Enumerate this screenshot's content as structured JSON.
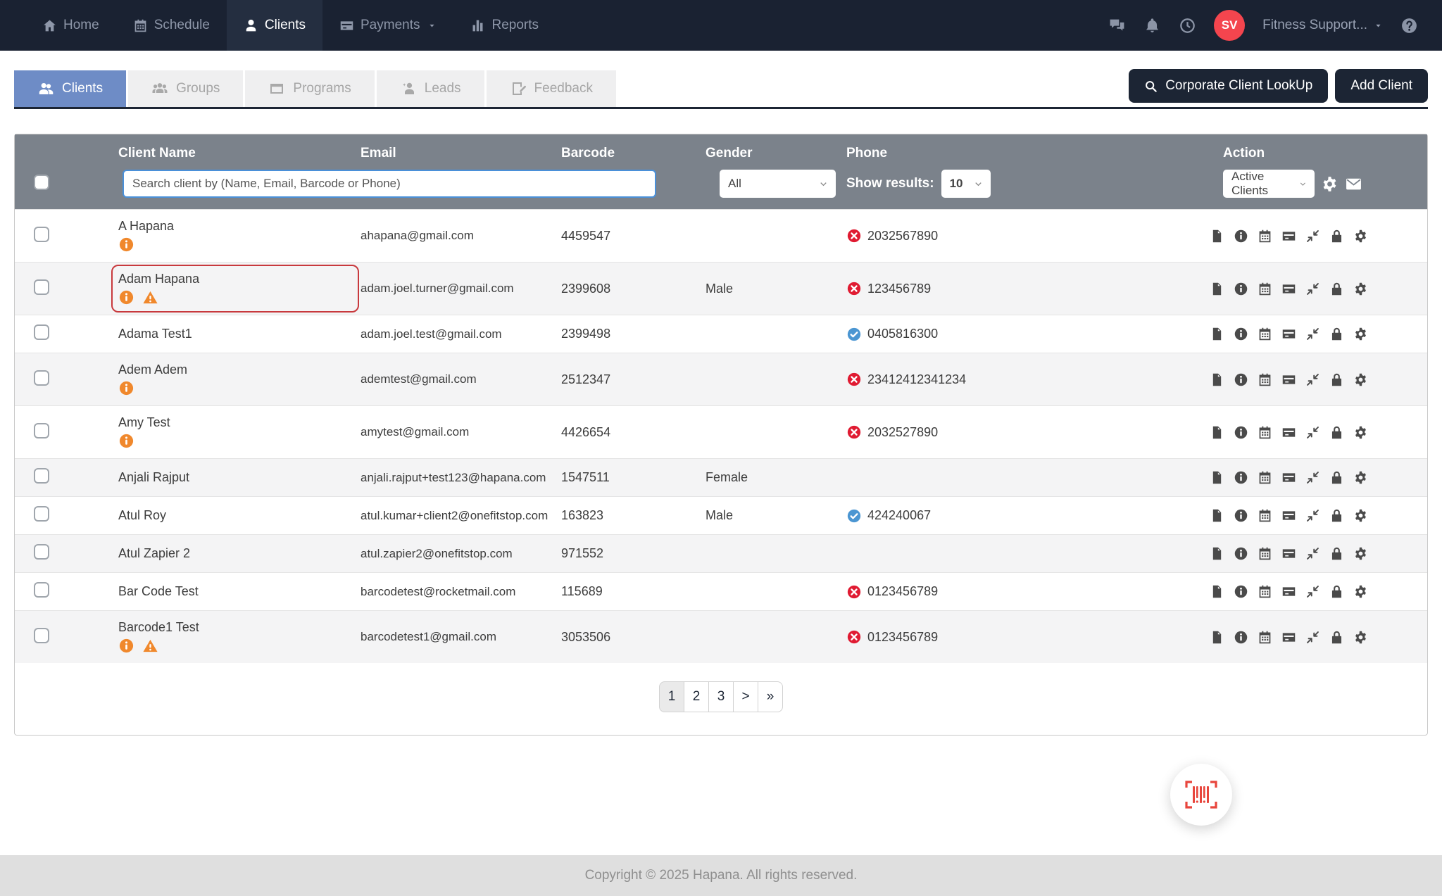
{
  "navbar": {
    "items": [
      {
        "label": "Home"
      },
      {
        "label": "Schedule"
      },
      {
        "label": "Clients"
      },
      {
        "label": "Payments"
      },
      {
        "label": "Reports"
      }
    ],
    "account": {
      "initials": "SV",
      "name": "Fitness Support..."
    }
  },
  "tabs": {
    "items": [
      {
        "label": "Clients"
      },
      {
        "label": "Groups"
      },
      {
        "label": "Programs"
      },
      {
        "label": "Leads"
      },
      {
        "label": "Feedback"
      }
    ]
  },
  "toolbar": {
    "corporate_lookup": "Corporate Client LookUp",
    "add_client": "Add Client"
  },
  "table": {
    "columns": {
      "name": "Client Name",
      "email": "Email",
      "barcode": "Barcode",
      "gender": "Gender",
      "phone": "Phone",
      "action": "Action"
    },
    "filters": {
      "search_placeholder": "Search client by (Name, Email, Barcode or Phone)",
      "gender": "All",
      "show_results_label": "Show results:",
      "show_results": "10",
      "list": "Active Clients"
    },
    "action_icons": [
      "notes-icon",
      "info-icon",
      "calendar-icon",
      "payment-card-icon",
      "merge-icon",
      "lock-icon",
      "settings-icon"
    ],
    "rows": [
      {
        "name": "A Hapana",
        "info": true,
        "warning": false,
        "email": "ahapana@gmail.com",
        "barcode": "4459547",
        "gender": "",
        "phone": "2032567890",
        "phone_status": "invalid",
        "highlighted": false
      },
      {
        "name": "Adam Hapana",
        "info": true,
        "warning": true,
        "email": "adam.joel.turner@gmail.com",
        "barcode": "2399608",
        "gender": "Male",
        "phone": "123456789",
        "phone_status": "invalid",
        "highlighted": true
      },
      {
        "name": "Adama Test1",
        "info": false,
        "warning": false,
        "email": "adam.joel.test@gmail.com",
        "barcode": "2399498",
        "gender": "",
        "phone": "0405816300",
        "phone_status": "verified",
        "highlighted": false
      },
      {
        "name": "Adem Adem",
        "info": true,
        "warning": false,
        "email": "ademtest@gmail.com",
        "barcode": "2512347",
        "gender": "",
        "phone": "23412412341234",
        "phone_status": "invalid",
        "highlighted": false
      },
      {
        "name": "Amy Test",
        "info": true,
        "warning": false,
        "email": "amytest@gmail.com",
        "barcode": "4426654",
        "gender": "",
        "phone": "2032527890",
        "phone_status": "invalid",
        "highlighted": false
      },
      {
        "name": "Anjali Rajput",
        "info": false,
        "warning": false,
        "email": "anjali.rajput+test123@hapana.com",
        "barcode": "1547511",
        "gender": "Female",
        "phone": "",
        "phone_status": null,
        "highlighted": false
      },
      {
        "name": "Atul Roy",
        "info": false,
        "warning": false,
        "email": "atul.kumar+client2@onefitstop.com",
        "barcode": "163823",
        "gender": "Male",
        "phone": "424240067",
        "phone_status": "verified",
        "highlighted": false
      },
      {
        "name": "Atul Zapier 2",
        "info": false,
        "warning": false,
        "email": "atul.zapier2@onefitstop.com",
        "barcode": "971552",
        "gender": "",
        "phone": "",
        "phone_status": null,
        "highlighted": false
      },
      {
        "name": "Bar Code Test",
        "info": false,
        "warning": false,
        "email": "barcodetest@rocketmail.com",
        "barcode": "115689",
        "gender": "",
        "phone": "0123456789",
        "phone_status": "invalid",
        "highlighted": false
      },
      {
        "name": "Barcode1 Test",
        "info": true,
        "warning": true,
        "email": "barcodetest1@gmail.com",
        "barcode": "3053506",
        "gender": "",
        "phone": "0123456789",
        "phone_status": "invalid",
        "highlighted": false
      }
    ]
  },
  "pagination": {
    "items": [
      "1",
      "2",
      "3",
      ">",
      "»"
    ],
    "active": "1"
  },
  "footer": {
    "copyright": "Copyright © 2025 Hapana. All rights reserved."
  },
  "colors": {
    "navy": "#1c2534",
    "navbar_bg": "#1a2232",
    "navbar_active": "#242e40",
    "tab_active": "#6e8cc6",
    "header_gray": "#7b828b",
    "avatar_red": "#f4454e",
    "accent_red": "#e8453c",
    "warning_orange": "#f0882c",
    "invalid_red": "#e01b32",
    "verified_blue": "#4b96d2",
    "highlight_red": "#c8393d"
  }
}
